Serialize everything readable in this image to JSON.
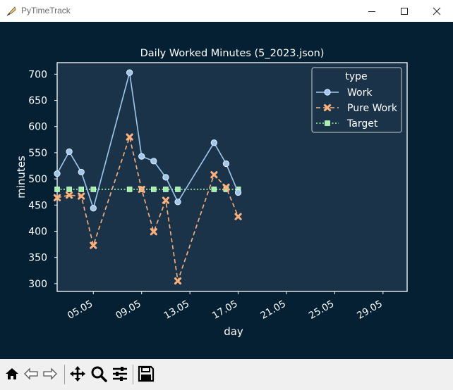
{
  "window": {
    "title": "PyTimeTrack",
    "icon": "feather-pen-icon"
  },
  "window_controls": [
    "minimize-icon",
    "maximize-icon",
    "close-icon"
  ],
  "colors": {
    "canvas_bg": "#042032",
    "axes_bg": "#1b3349",
    "work": "#9ec7f0",
    "pure_work": "#fbb17e",
    "target": "#9ff5a6",
    "text": "#ffffff"
  },
  "toolbar": {
    "buttons": [
      "home-icon",
      "back-arrow-icon",
      "forward-arrow-icon",
      "pan-icon",
      "zoom-icon",
      "configure-subplots-icon",
      "save-icon"
    ]
  },
  "chart_data": {
    "type": "line",
    "title": "Daily Worked Minutes (5_2023.json)",
    "xlabel": "day",
    "ylabel": "minutes",
    "x_tick_labels": [
      "05.05",
      "09.05",
      "13.05",
      "17.05",
      "21.05",
      "25.05",
      "29.05"
    ],
    "y_ticks": [
      300,
      350,
      400,
      450,
      500,
      550,
      600,
      650,
      700
    ],
    "xlim": [
      "2023-05-02",
      "2023-05-31"
    ],
    "ylim": [
      285,
      722
    ],
    "grid": false,
    "legend": {
      "title": "type",
      "placement": "top-right"
    },
    "x": [
      "2023-05-02",
      "2023-05-03",
      "2023-05-04",
      "2023-05-05",
      "2023-05-08",
      "2023-05-09",
      "2023-05-10",
      "2023-05-11",
      "2023-05-12",
      "2023-05-15",
      "2023-05-16",
      "2023-05-17"
    ],
    "series": [
      {
        "name": "Work",
        "marker": "circle",
        "style": "solid",
        "values": [
          510,
          552,
          513,
          444,
          703,
          543,
          534,
          503,
          456,
          569,
          529,
          474
        ]
      },
      {
        "name": "Pure Work",
        "marker": "x",
        "style": "dashed",
        "values": [
          464,
          469,
          467,
          373,
          580,
          480,
          399,
          459,
          305,
          508,
          484,
          428
        ]
      },
      {
        "name": "Target",
        "marker": "square",
        "style": "dotted",
        "values": [
          480,
          480,
          480,
          480,
          480,
          480,
          480,
          480,
          480,
          480,
          480,
          480
        ]
      }
    ]
  }
}
